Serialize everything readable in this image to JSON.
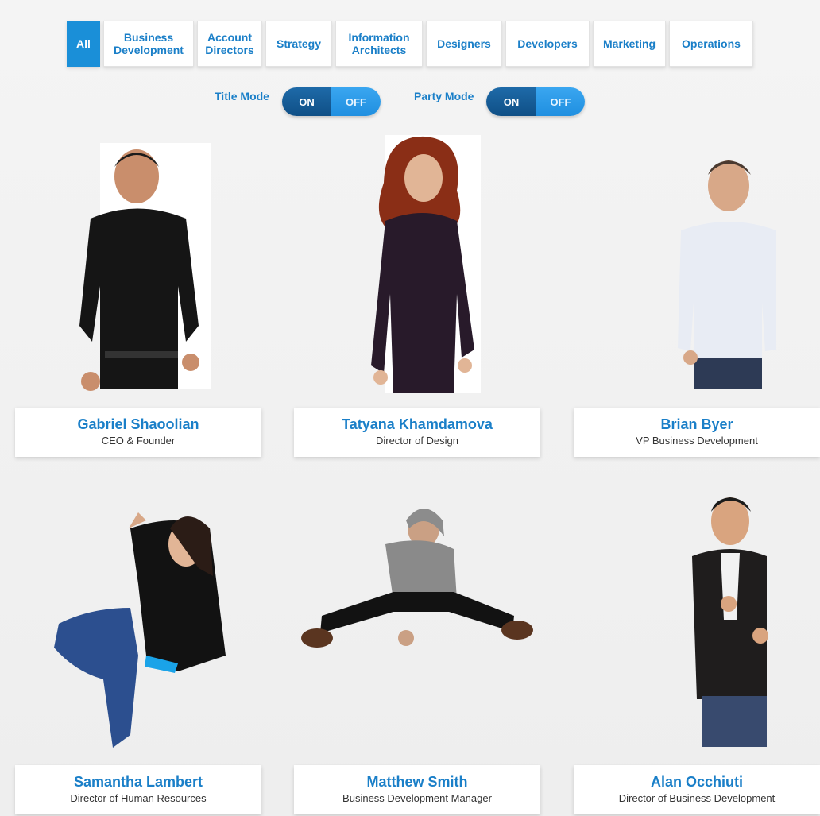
{
  "filters": [
    {
      "label": "All",
      "active": true
    },
    {
      "label": "Business\nDevelopment"
    },
    {
      "label": "Account\nDirectors"
    },
    {
      "label": "Strategy"
    },
    {
      "label": "Information\nArchitects"
    },
    {
      "label": "Designers"
    },
    {
      "label": "Developers"
    },
    {
      "label": "Marketing"
    },
    {
      "label": "Operations"
    }
  ],
  "toggles": {
    "title_mode": {
      "label": "Title Mode",
      "on": "ON",
      "off": "OFF"
    },
    "party_mode": {
      "label": "Party Mode",
      "on": "ON",
      "off": "OFF"
    }
  },
  "team": [
    {
      "name": "Gabriel Shaoolian",
      "role": "CEO & Founder"
    },
    {
      "name": "Tatyana Khamdamova",
      "role": "Director of Design"
    },
    {
      "name": "Brian Byer",
      "role": "VP Business Development"
    },
    {
      "name": "Samantha Lambert",
      "role": "Director of Human Resources"
    },
    {
      "name": "Matthew Smith",
      "role": "Business Development Manager"
    },
    {
      "name": "Alan Occhiuti",
      "role": "Director of Business Development"
    }
  ],
  "colors": {
    "accent": "#1a7fc8",
    "active_tab": "#1a8fd8",
    "toggle_on": "#0f4f86",
    "toggle_off": "#1f8fe0"
  }
}
